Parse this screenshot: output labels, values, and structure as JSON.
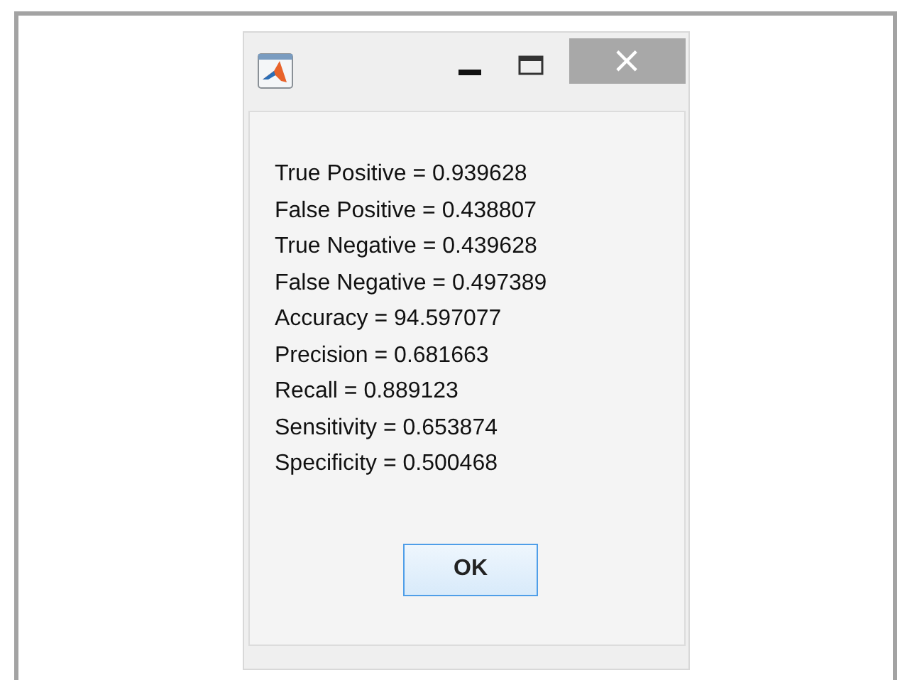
{
  "dialog": {
    "lines": [
      "True Positive = 0.939628",
      "False Positive = 0.438807",
      "True Negative = 0.439628",
      "False Negative = 0.497389",
      "Accuracy = 94.597077",
      "Precision = 0.681663",
      "Recall = 0.889123",
      "Sensitivity = 0.653874",
      "Specificity = 0.500468"
    ],
    "close_glyph": "×",
    "button": "OK"
  }
}
